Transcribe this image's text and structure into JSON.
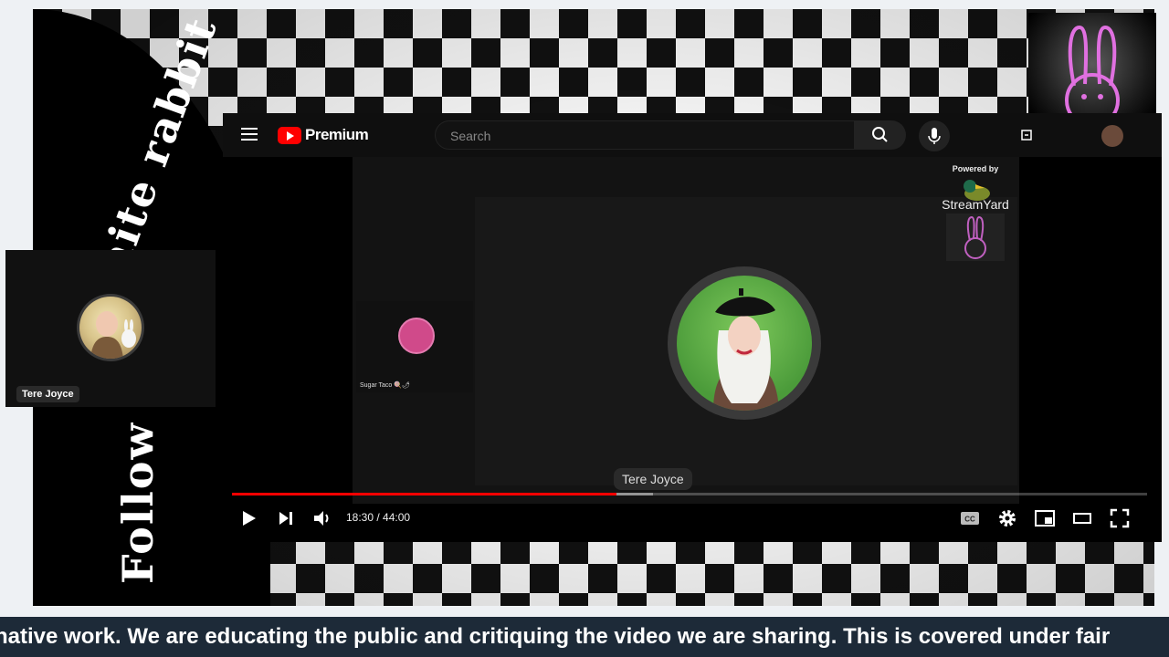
{
  "background": {
    "banner_text": "Follow the white rabbit",
    "banner_top_fragment": "hite rabbit",
    "banner_left_fragment": "Follow"
  },
  "youtube": {
    "brand": "Premium",
    "search": {
      "placeholder": "Search"
    },
    "player": {
      "current_time": "18:30",
      "duration": "44:00",
      "time_text": "18:30 / 44:00",
      "played_fraction": 0.42,
      "loaded_fraction": 0.46
    }
  },
  "streamyard": {
    "powered_by": "Powered by",
    "brand": "StreamYard",
    "main_speaker": "Tere Joyce",
    "guest_name": "Sugar Taco 🍭🌶"
  },
  "side_tile": {
    "name": "Tere Joyce"
  },
  "ticker": {
    "text": "native work. We are educating the public and critiquing the video we are sharing. This is covered under fair"
  },
  "colors": {
    "youtube_red": "#ff0000",
    "ticker_bg": "#1d2a38",
    "bunny_pink": "#e070e0"
  }
}
